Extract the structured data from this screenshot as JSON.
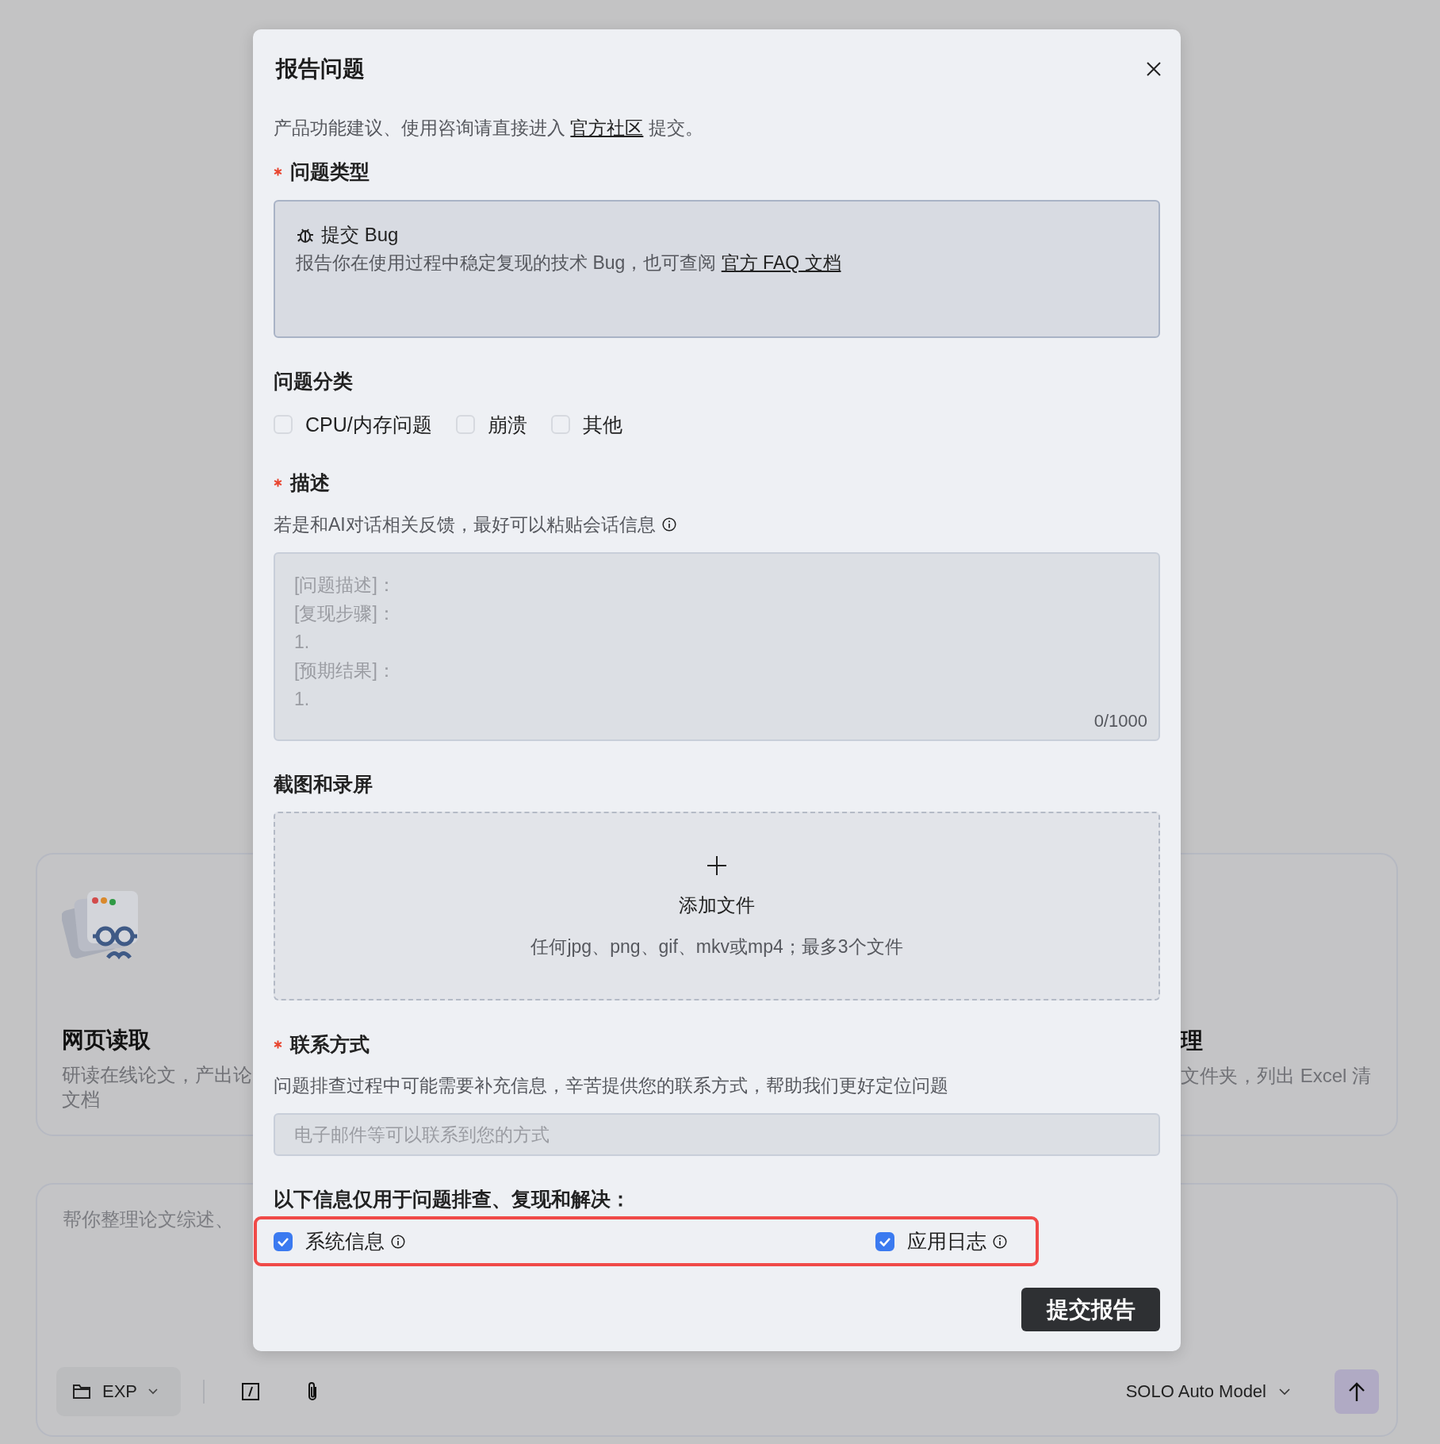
{
  "background": {
    "cards": [
      {
        "kind": "illustrated",
        "title": "网页读取",
        "description_lines": [
          "研读在线论文，产出论",
          "文档"
        ]
      },
      {
        "kind": "plain",
        "title": "理",
        "description_lines": [
          "文件夹，列出 Excel 清"
        ]
      }
    ],
    "prompt": {
      "placeholder": "帮你整理论文综述、",
      "folder_button": {
        "label": "EXP"
      },
      "model_selector": {
        "label": "SOLO Auto Model"
      }
    }
  },
  "dialog": {
    "title": "报告问题",
    "intro": {
      "text_before": "产品功能建议、使用咨询请直接进入",
      "link": "官方社区",
      "text_after": "提交。"
    },
    "fields": [
      {
        "kind": "type_card",
        "label": "问题类型",
        "required": true,
        "option": {
          "title": "提交 Bug",
          "description": "报告你在使用过程中稳定复现的技术 Bug，也可查阅",
          "link": "官方 FAQ 文档",
          "selected": true
        }
      },
      {
        "kind": "checkboxes",
        "label": "问题分类",
        "required": false,
        "options": [
          {
            "label": "CPU/内存问题",
            "checked": false
          },
          {
            "label": "崩溃",
            "checked": false
          },
          {
            "label": "其他",
            "checked": false
          }
        ]
      },
      {
        "kind": "textarea",
        "label": "描述",
        "required": true,
        "hint": "若是和AI对话相关反馈，最好可以粘贴会话信息",
        "placeholder": "[问题描述]：\n[复现步骤]：\n1.\n[预期结果]：\n1.",
        "counter": "0/1000"
      },
      {
        "kind": "upload",
        "label": "截图和录屏",
        "required": false,
        "action": "添加文件",
        "hint": "任何jpg、png、gif、mkv或mp4；最多3个文件"
      },
      {
        "kind": "input",
        "label": "联系方式",
        "required": true,
        "hint": "问题排查过程中可能需要补充信息，辛苦提供您的联系方式，帮助我们更好定位问题",
        "placeholder": "电子邮件等可以联系到您的方式"
      },
      {
        "kind": "consent",
        "label": "以下信息仅用于问题排查、复现和解决：",
        "highlighted": true,
        "options": [
          {
            "label": "系统信息",
            "checked": true
          },
          {
            "label": "应用日志",
            "checked": true
          }
        ]
      }
    ],
    "submit": "提交报告"
  }
}
